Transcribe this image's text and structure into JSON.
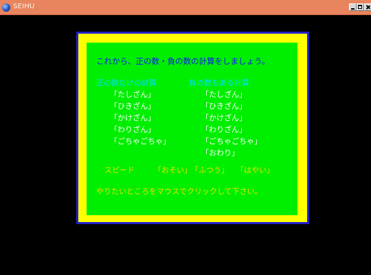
{
  "window": {
    "title": "SEIHU",
    "icon": "app-globe-icon"
  },
  "content": {
    "intro": "これから、正の数・負の数の計算をしましょう。",
    "column_headers": [
      "正の数だけの計算",
      "負の数もある計算"
    ],
    "positive_items": [
      "「たしざん」",
      "「ひきざん」",
      "「かけざん」",
      "「わりざん」",
      "「ごちゃごちゃ」"
    ],
    "negative_items": [
      "「たしざん」",
      "「ひきざん」",
      "「かけざん」",
      "「わりざん」",
      "「ごちゃごちゃ」",
      "「おわり」"
    ],
    "speed": {
      "label": "スピード",
      "options": [
        "「おそい」",
        "「ふつう」",
        "「はやい」"
      ]
    },
    "footer": "やりたいところをマウスでクリックして下さい。"
  },
  "colors": {
    "background": "#000000",
    "titlebar": "#e8845e",
    "outer_border": "#1f1fd0",
    "frame": "#ffff00",
    "panel": "#00ef00",
    "intro_text": "#1010ff",
    "header_text": "#00e0ff",
    "item_text": "#ffffff",
    "speed_footer_text": "#f0e000"
  }
}
